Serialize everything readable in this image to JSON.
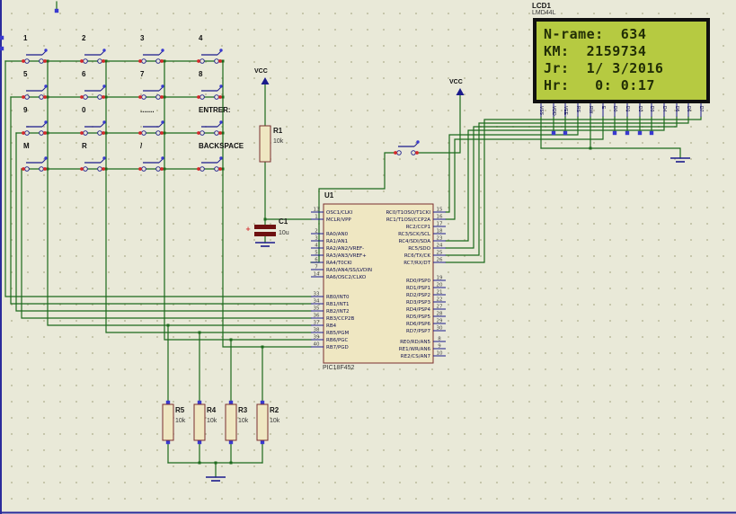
{
  "keypad": {
    "buttons": [
      {
        "label": "1"
      },
      {
        "label": "2"
      },
      {
        "label": "3"
      },
      {
        "label": "4"
      },
      {
        "label": "5"
      },
      {
        "label": "6"
      },
      {
        "label": "7"
      },
      {
        "label": "8"
      },
      {
        "label": "9"
      },
      {
        "label": "0"
      },
      {
        "label": "......."
      },
      {
        "label": "ENTRER:"
      },
      {
        "label": "M"
      },
      {
        "label": "R"
      },
      {
        "label": "/"
      },
      {
        "label": "BACKSPACE"
      }
    ]
  },
  "mcu": {
    "ref": "U1",
    "part": "PIC18F452",
    "left_pin_groups": [
      [
        {
          "num": "13",
          "name": "OSC1/CLKI"
        },
        {
          "num": "1",
          "name": "MCLR/VPP"
        }
      ],
      [
        {
          "num": "2",
          "name": "RA0/AN0"
        },
        {
          "num": "3",
          "name": "RA1/AN1"
        },
        {
          "num": "4",
          "name": "RA2/AN2/VREF-"
        },
        {
          "num": "5",
          "name": "RA3/AN3/VREF+"
        },
        {
          "num": "6",
          "name": "RA4/T0CKI"
        },
        {
          "num": "7",
          "name": "RA5/AN4/SS/LVDIN"
        },
        {
          "num": "14",
          "name": "RA6/OSC2/CLKO"
        }
      ],
      [
        {
          "num": "33",
          "name": "RB0/INT0"
        },
        {
          "num": "34",
          "name": "RB1/INT1"
        },
        {
          "num": "35",
          "name": "RB2/INT2"
        },
        {
          "num": "36",
          "name": "RB3/CCP2B"
        },
        {
          "num": "37",
          "name": "RB4"
        },
        {
          "num": "38",
          "name": "RB5/PGM"
        },
        {
          "num": "39",
          "name": "RB6/PGC"
        },
        {
          "num": "40",
          "name": "RB7/PGD"
        }
      ]
    ],
    "right_pin_groups": [
      [
        {
          "num": "15",
          "name": "RC0/T1OSO/T1CKI"
        },
        {
          "num": "16",
          "name": "RC1/T1OSI/CCP2A"
        },
        {
          "num": "17",
          "name": "RC2/CCP1"
        },
        {
          "num": "18",
          "name": "RC3/SCK/SCL"
        },
        {
          "num": "23",
          "name": "RC4/SDI/SDA"
        },
        {
          "num": "24",
          "name": "RC5/SDO"
        },
        {
          "num": "25",
          "name": "RC6/TX/CK"
        },
        {
          "num": "26",
          "name": "RC7/RX/DT"
        }
      ],
      [
        {
          "num": "19",
          "name": "RD0/PSP0"
        },
        {
          "num": "20",
          "name": "RD1/PSP1"
        },
        {
          "num": "21",
          "name": "RD2/PSP2"
        },
        {
          "num": "22",
          "name": "RD3/PSP3"
        },
        {
          "num": "27",
          "name": "RD4/PSP4"
        },
        {
          "num": "28",
          "name": "RD5/PSP5"
        },
        {
          "num": "29",
          "name": "RD6/PSP6"
        },
        {
          "num": "30",
          "name": "RD7/PSP7"
        }
      ],
      [
        {
          "num": "8",
          "name": "RE0/RD/AN5"
        },
        {
          "num": "9",
          "name": "RE1/WR/AN6"
        },
        {
          "num": "10",
          "name": "RE2/CS/AN7"
        }
      ]
    ]
  },
  "lcd": {
    "ref": "LCD1",
    "part": "LMD44L",
    "lines": [
      "N-rame:  634",
      "KM:  2159734",
      "Jr:  1/ 3/2016",
      "Hr:   0: 0:17"
    ],
    "pins": [
      "VSS",
      "VDD",
      "VEE",
      "RS",
      "RW",
      "E",
      "D0",
      "D1",
      "D2",
      "D3",
      "D4",
      "D5",
      "D6",
      "D7"
    ]
  },
  "resistors": [
    {
      "ref": "R1",
      "value": "10k"
    },
    {
      "ref": "R5",
      "value": "10k"
    },
    {
      "ref": "R4",
      "value": "10k"
    },
    {
      "ref": "R3",
      "value": "10k"
    },
    {
      "ref": "R2",
      "value": "10k"
    }
  ],
  "capacitors": [
    {
      "ref": "C1",
      "value": "10u"
    }
  ],
  "power": {
    "vcc_label": "VCC"
  },
  "colors": {
    "wire": "#1c6a1c",
    "component_outline": "#7a2e2e",
    "component_fill": "#efe7c2",
    "pin": "#1a1a8c",
    "lcd_screen": "#b6ca41",
    "lcd_text": "#222e06",
    "junction": "#1c6a1c",
    "dangling_end": "#3939cf",
    "terminal_red": "#d42a2a",
    "background": "#e9e9d8"
  }
}
